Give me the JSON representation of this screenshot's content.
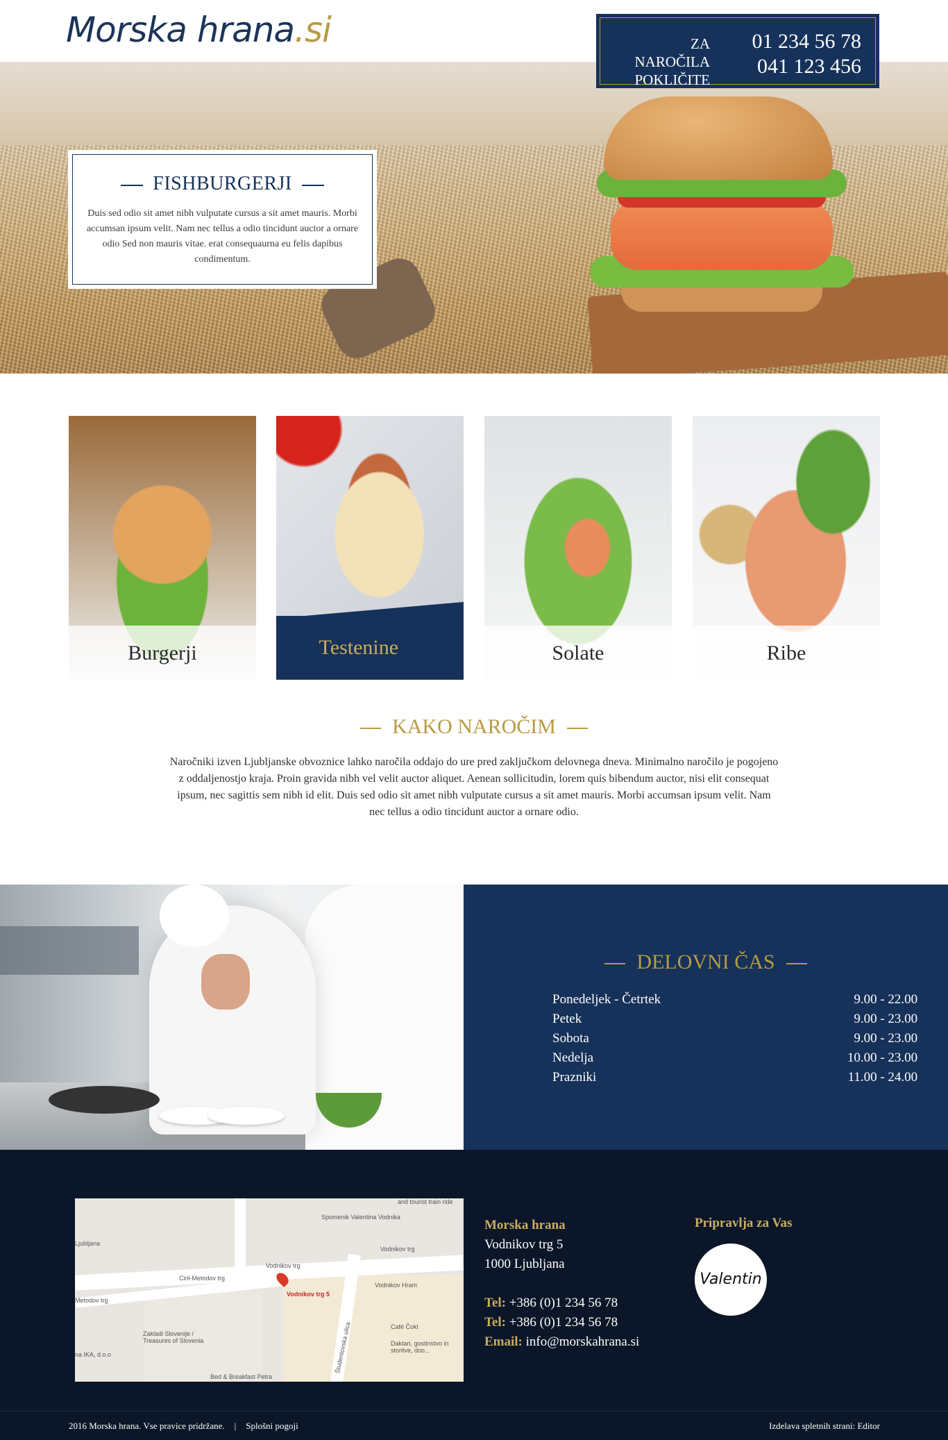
{
  "header": {
    "logo_main": "Morska hrana",
    "logo_tld": ".si",
    "phone_label_line1": "ZA NAROČILA",
    "phone_label_line2": "POKLIČITE",
    "phone1": "01 234 56 78",
    "phone2": "041 123 456"
  },
  "hero": {
    "title": "FISHBURGERJI",
    "text": "Duis sed odio sit amet nibh vulputate cursus a sit amet mauris. Morbi accumsan ipsum velit. Nam nec tellus a odio tincidunt auctor a ornare odio Sed non  mauris vitae.  erat consequaurna eu felis dapibus condimentum."
  },
  "categories": [
    {
      "label": "Burgerji"
    },
    {
      "label": "Testenine"
    },
    {
      "label": "Solate"
    },
    {
      "label": "Ribe"
    }
  ],
  "kako": {
    "title": "KAKO NAROČIM",
    "text": "Naročniki izven Ljubljanske obvoznice lahko naročila oddajo do ure pred zaključkom delovnega dneva. Minimalno naročilo je pogojeno z oddaljenostjo kraja. Proin gravida nibh vel velit auctor aliquet. Aenean sollicitudin, lorem quis bibendum auctor, nisi elit consequat ipsum, nec sagittis sem nibh id elit. Duis sed odio sit amet nibh vulputate cursus a sit amet mauris.  Morbi accumsan ipsum velit.  Nam nec tellus a odio tincidunt auctor a ornare odio."
  },
  "hours": {
    "title": "DELOVNI ČAS",
    "rows": [
      {
        "day": "Ponedeljek - Četrtek",
        "time": "9.00 - 22.00"
      },
      {
        "day": "Petek",
        "time": "9.00 - 23.00"
      },
      {
        "day": "Sobota",
        "time": "9.00 - 23.00"
      },
      {
        "day": "Nedelja",
        "time": "10.00 - 23.00"
      },
      {
        "day": "Prazniki",
        "time": "11.00 - 24.00"
      }
    ]
  },
  "map": {
    "street1": "Vodnikov trg",
    "street2": "Vodnikov trg",
    "street3": "Ciril-Metodov trg",
    "street4": "Metodov trg",
    "poi1": "Spomenik Valentina Vodnika",
    "poi2": "and tourist train ride",
    "poi3": "Ljubljana",
    "poi4": "Vodnikov Hram",
    "poi5": "Zakladi Slovenije / Treasures of Slovenia",
    "poi6": "Café Čokl",
    "poi7": "Daktari, gostinstvo in storitve, doo...",
    "poi8": "na IKA, d.o.o",
    "poi9": "Bed & Breakfast Petra",
    "poi10": "Študentovska ulica",
    "pin_label": "Vodnikov trg 5"
  },
  "footer": {
    "company": "Morska hrana",
    "street": "Vodnikov trg 5",
    "city": "1000 Ljubljana",
    "tel_label": "Tel:",
    "tel1": "+386 (0)1 234 56 78",
    "tel2": "+386 (0)1 234 56 78",
    "email_label": "Email:",
    "email": "info@morskahrana.si",
    "prep_title": "Pripravlja za Vas",
    "prep_logo": "Valentin",
    "copyright": "2016 Morska hrana. Vse pravice pridržane.",
    "sep": "|",
    "terms": "Splošni pogoji",
    "credit": "Izdelava spletnih strani: Editor"
  },
  "colors": {
    "navy": "#16325a",
    "gold": "#b89b42",
    "footer_bg": "#0b1628"
  }
}
